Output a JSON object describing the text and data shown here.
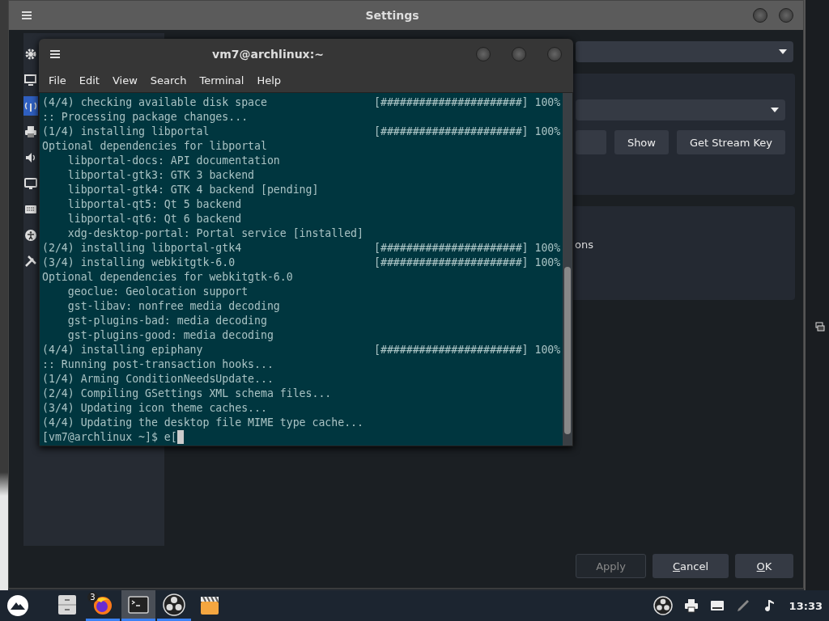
{
  "settings_window": {
    "title": "Settings",
    "sidebar": {
      "items": [
        {
          "kind": "gear",
          "selected": false
        },
        {
          "kind": "monitor",
          "selected": false
        },
        {
          "kind": "antenna",
          "selected": true
        },
        {
          "kind": "printer",
          "selected": false
        },
        {
          "kind": "speaker",
          "selected": false
        },
        {
          "kind": "screen",
          "selected": false
        },
        {
          "kind": "keyboard",
          "selected": false
        },
        {
          "kind": "accessibility",
          "selected": false
        },
        {
          "kind": "tools",
          "selected": false
        }
      ]
    },
    "stream_buttons": [
      "Show",
      "Get Stream Key"
    ],
    "partial_label": "ons",
    "buttons": [
      {
        "label": "Apply",
        "disabled": true,
        "mnemonic": false
      },
      {
        "label": "Cancel",
        "disabled": false,
        "mnemonic": true
      },
      {
        "label": "OK",
        "disabled": false,
        "mnemonic": true
      }
    ]
  },
  "terminal_window": {
    "title": "vm7@archlinux:~",
    "menu": [
      "File",
      "Edit",
      "View",
      "Search",
      "Terminal",
      "Help"
    ],
    "lines": [
      {
        "text": "(4/4) checking available disk space",
        "progress": "[######################] 100%"
      },
      {
        "text": ":: Processing package changes..."
      },
      {
        "text": "(1/4) installing libportal",
        "progress": "[######################] 100%"
      },
      {
        "text": "Optional dependencies for libportal"
      },
      {
        "text": "    libportal-docs: API documentation"
      },
      {
        "text": "    libportal-gtk3: GTK 3 backend"
      },
      {
        "text": "    libportal-gtk4: GTK 4 backend [pending]"
      },
      {
        "text": "    libportal-qt5: Qt 5 backend"
      },
      {
        "text": "    libportal-qt6: Qt 6 backend"
      },
      {
        "text": "    xdg-desktop-portal: Portal service [installed]"
      },
      {
        "text": "(2/4) installing libportal-gtk4",
        "progress": "[######################] 100%"
      },
      {
        "text": "(3/4) installing webkitgtk-6.0",
        "progress": "[######################] 100%"
      },
      {
        "text": "Optional dependencies for webkitgtk-6.0"
      },
      {
        "text": "    geoclue: Geolocation support"
      },
      {
        "text": "    gst-libav: nonfree media decoding"
      },
      {
        "text": "    gst-plugins-bad: media decoding"
      },
      {
        "text": "    gst-plugins-good: media decoding"
      },
      {
        "text": "(4/4) installing epiphany",
        "progress": "[######################] 100%"
      },
      {
        "text": ":: Running post-transaction hooks..."
      },
      {
        "text": "(1/4) Arming ConditionNeedsUpdate..."
      },
      {
        "text": "(2/4) Compiling GSettings XML schema files..."
      },
      {
        "text": "(3/4) Updating icon theme caches..."
      },
      {
        "text": "(4/4) Updating the desktop file MIME type cache..."
      }
    ],
    "prompt": "[vm7@archlinux ~]$ e["
  },
  "taskbar": {
    "apps": [
      {
        "kind": "files",
        "running": false,
        "selected": false
      },
      {
        "kind": "browser",
        "running": true,
        "selected": false,
        "badge": "3"
      },
      {
        "kind": "terminal",
        "running": true,
        "selected": true
      },
      {
        "kind": "obs",
        "running": true,
        "selected": false
      },
      {
        "kind": "clapper",
        "running": false,
        "selected": false
      }
    ],
    "tray": [
      {
        "kind": "obs"
      },
      {
        "kind": "printer"
      },
      {
        "kind": "keyboard"
      },
      {
        "kind": "pen"
      },
      {
        "kind": "note"
      }
    ],
    "clock": "13:33"
  }
}
